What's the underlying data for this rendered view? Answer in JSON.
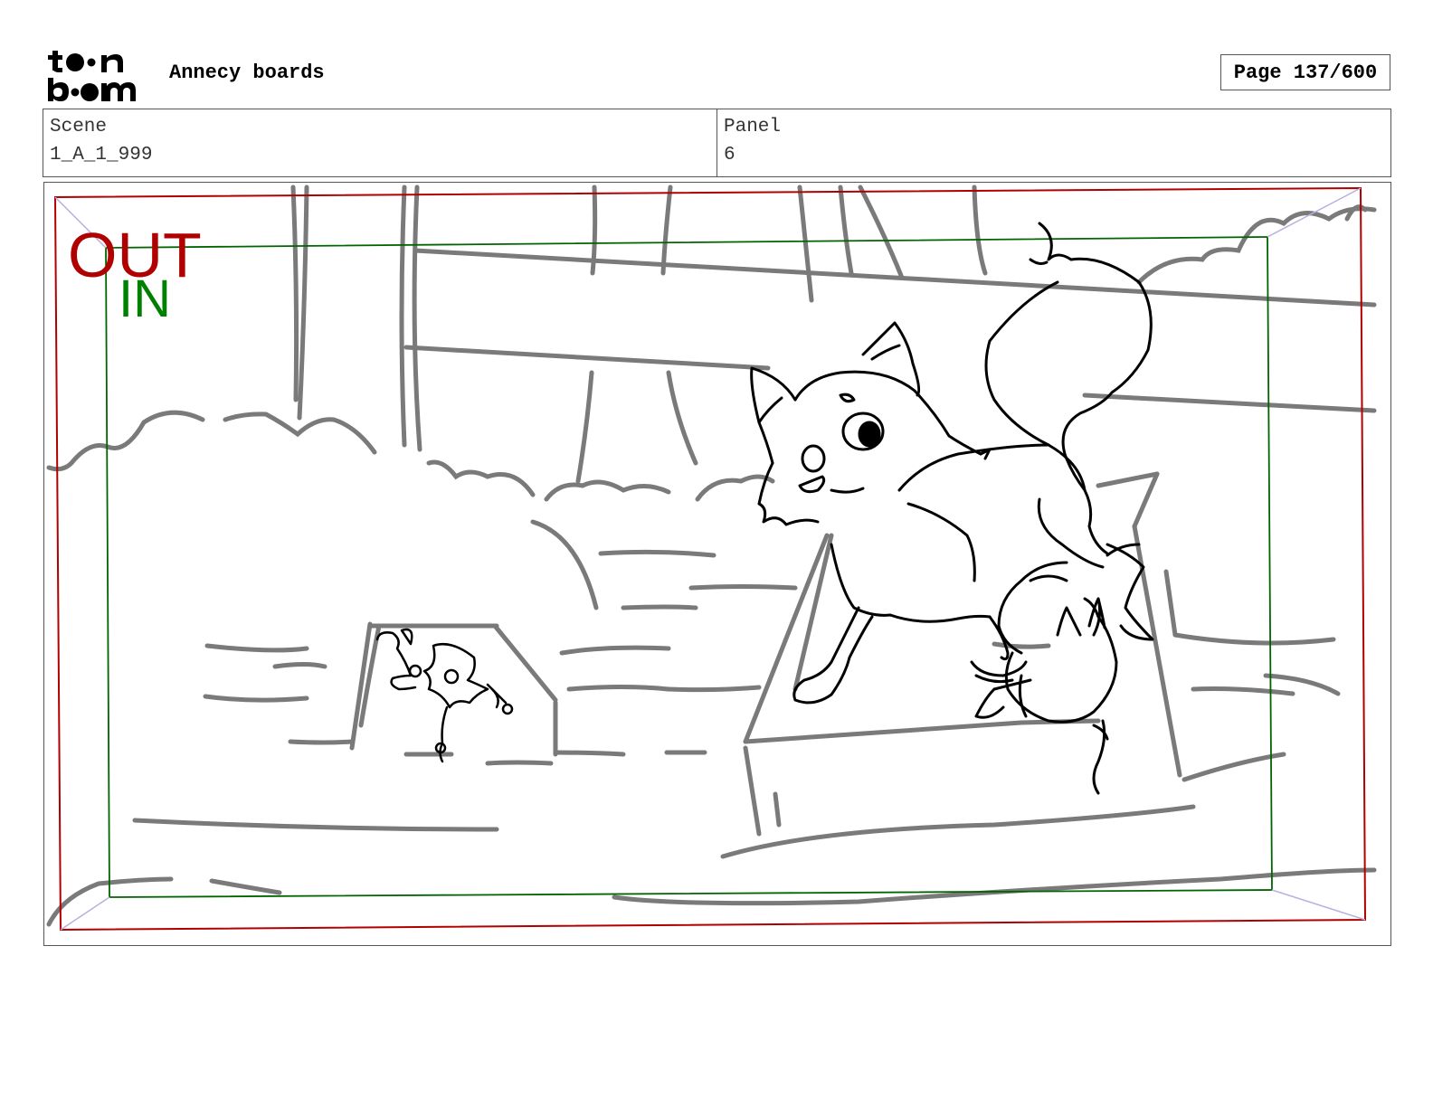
{
  "header": {
    "logo_text": "toon boom",
    "title": "Annecy boards",
    "page_indicator": "Page 137/600"
  },
  "info": {
    "scene_label": "Scene",
    "scene_value": "1_A_1_999",
    "panel_label": "Panel",
    "panel_value": "6"
  },
  "frame": {
    "out_label": "OUT",
    "in_label": "IN",
    "out_color": "#b00000",
    "in_color": "#008000"
  }
}
